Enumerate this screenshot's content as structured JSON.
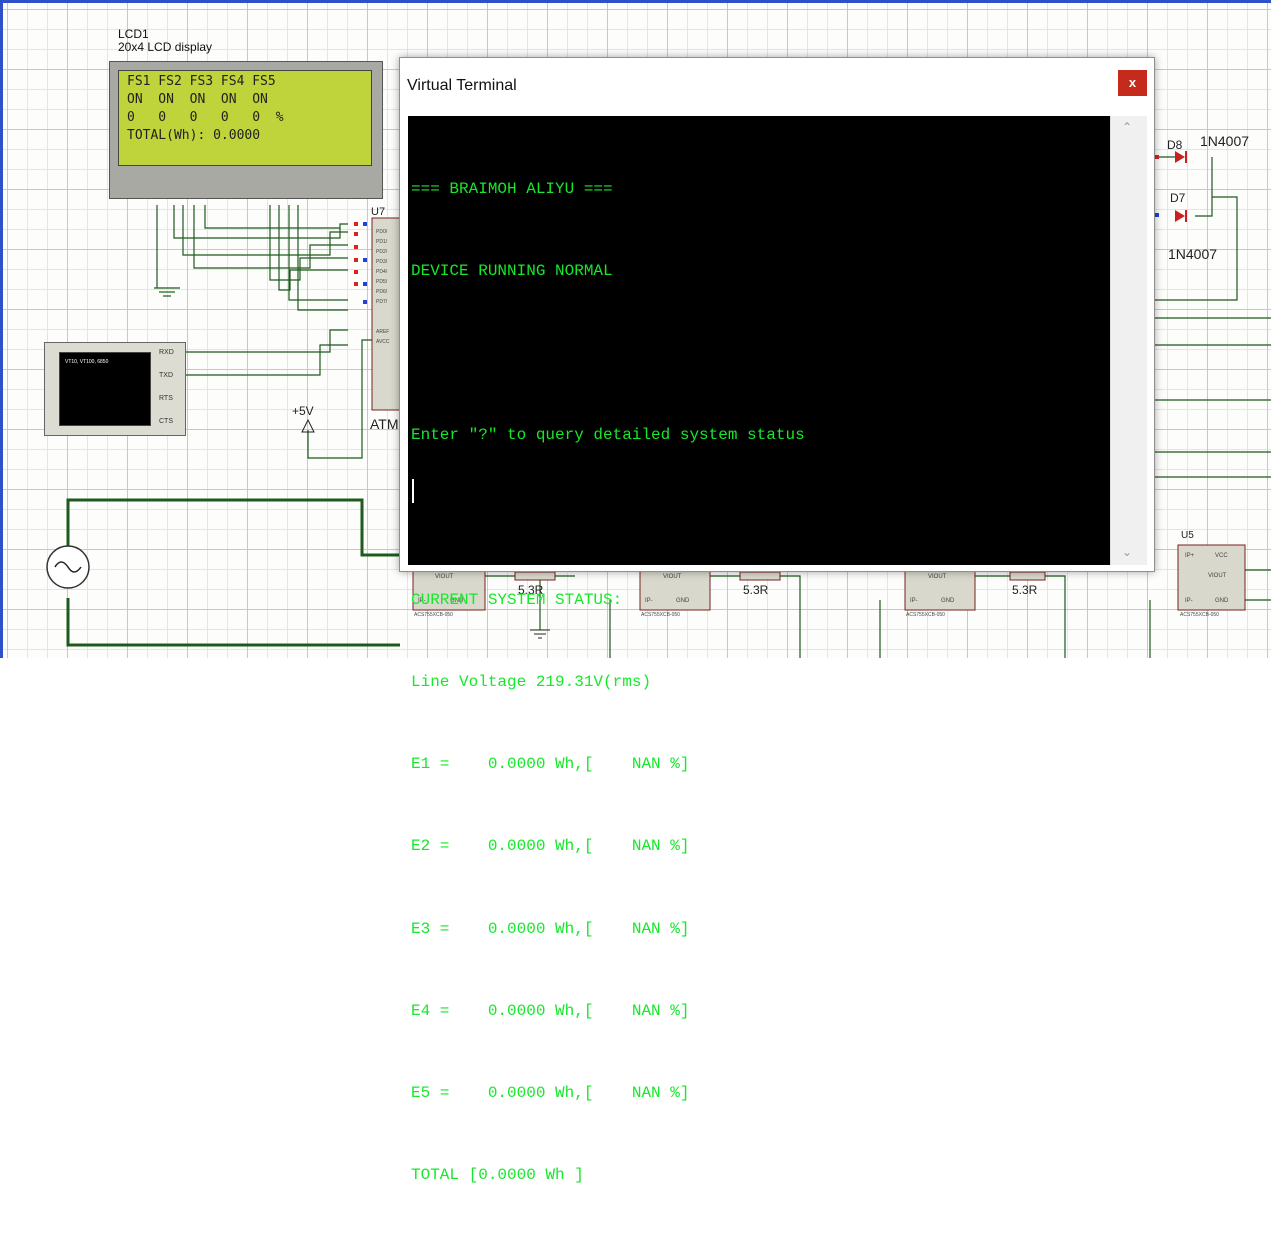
{
  "lcd": {
    "name": "LCD1",
    "type": "20x4 LCD display",
    "lines": [
      "FS1 FS2 FS3 FS4 FS5",
      "ON  ON  ON  ON  ON",
      "0   0   0   0   0  %",
      "TOTAL(Wh): 0.0000"
    ]
  },
  "schematic": {
    "u7_label": "U7",
    "u7_name": "ATM",
    "vcc_label": "+5V",
    "vt_symbol_text": "VT10, VT100, 6850",
    "vt_pins": [
      "RXD",
      "TXD",
      "RTS",
      "CTS"
    ],
    "diodes": [
      {
        "ref": "D8",
        "part": "1N4007"
      },
      {
        "ref": "D7",
        "part": "1N4007"
      }
    ],
    "u5_label": "U5",
    "resistors": [
      "5.3R",
      "5.3R",
      "5.3R"
    ],
    "sensor_chip": "ACS755XCB-050",
    "sensor_pins": [
      "VIOUT",
      "IP-",
      "GND",
      "IP+",
      "VCC"
    ]
  },
  "terminal": {
    "title": "Virtual Terminal",
    "close_label": "x",
    "lines": [
      "=== BRAIMOH ALIYU ===",
      "DEVICE RUNNING NORMAL",
      "",
      "Enter \"?\" to query detailed system status",
      "",
      "CURRENT SYSTEM STATUS:",
      "Line Voltage 219.31V(rms)",
      "E1 =    0.0000 Wh,[    NAN %]",
      "E2 =    0.0000 Wh,[    NAN %]",
      "E3 =    0.0000 Wh,[    NAN %]",
      "E4 =    0.0000 Wh,[    NAN %]",
      "E5 =    0.0000 Wh,[    NAN %]",
      "TOTAL [0.0000 Wh ]"
    ]
  },
  "colors": {
    "terminal_text": "#16e82a",
    "terminal_bg": "#000000",
    "close_button": "#c42b1c",
    "wire": "#1d5a1d",
    "lcd_screen": "#bfd33b"
  }
}
